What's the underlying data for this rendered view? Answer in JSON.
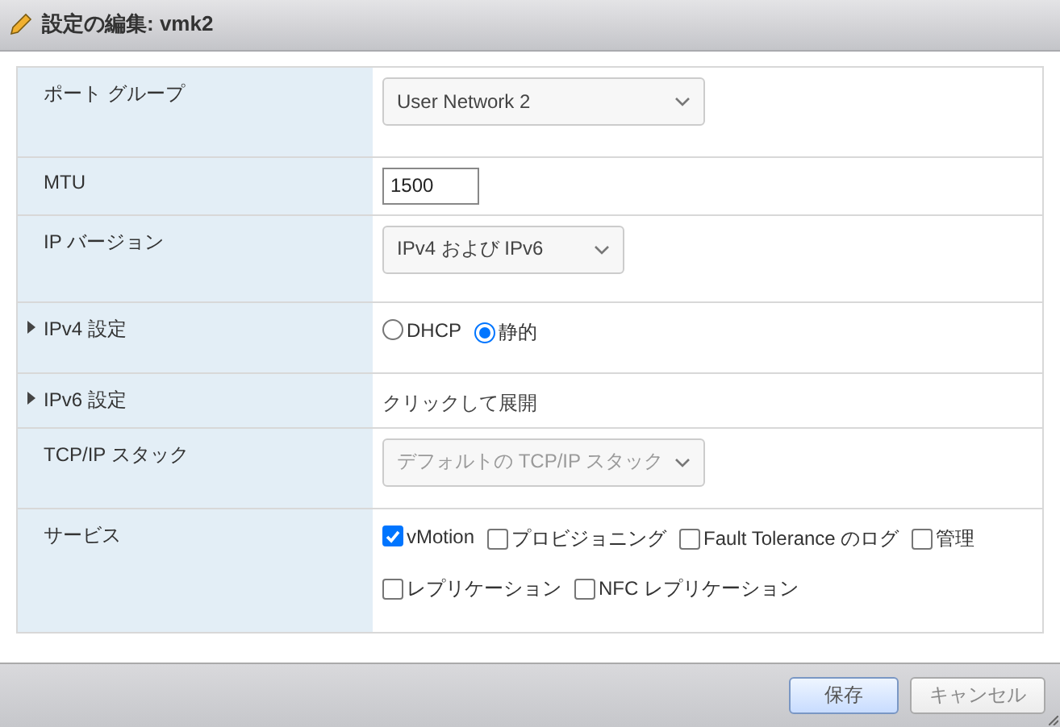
{
  "window": {
    "title": "設定の編集: vmk2"
  },
  "rows": [
    {
      "label": "ポート グループ",
      "kind": "select",
      "value": "User Network 2",
      "disabled": false
    },
    {
      "label": "MTU",
      "kind": "input",
      "value": "1500"
    },
    {
      "label": "IP バージョン",
      "kind": "compact-select",
      "value": "IPv4 および IPv6",
      "disabled": false
    },
    {
      "label": "IPv4 設定",
      "expanded": false,
      "kind": "radios",
      "options": [
        {
          "label": "DHCP",
          "selected": false
        },
        {
          "label": "静的",
          "selected": true
        }
      ]
    },
    {
      "label": "IPv6 設定",
      "expanded": false,
      "kind": "text",
      "value": "クリックして展開"
    },
    {
      "label": "TCP/IP スタック",
      "kind": "select",
      "value": "デフォルトの TCP/IP スタック",
      "disabled": true
    },
    {
      "label": "サービス",
      "kind": "checkboxes",
      "options": [
        {
          "label": "vMotion",
          "checked": true
        },
        {
          "label": "プロビジョニング",
          "checked": false
        },
        {
          "label": "Fault Tolerance のログ",
          "checked": false
        },
        {
          "label": "管理",
          "checked": false
        },
        {
          "label": "レプリケーション",
          "checked": false
        },
        {
          "label": "NFC レプリケーション",
          "checked": false
        }
      ]
    }
  ],
  "buttons": [
    {
      "label": "保存",
      "primary": true
    },
    {
      "label": "キャンセル",
      "primary": false
    }
  ]
}
